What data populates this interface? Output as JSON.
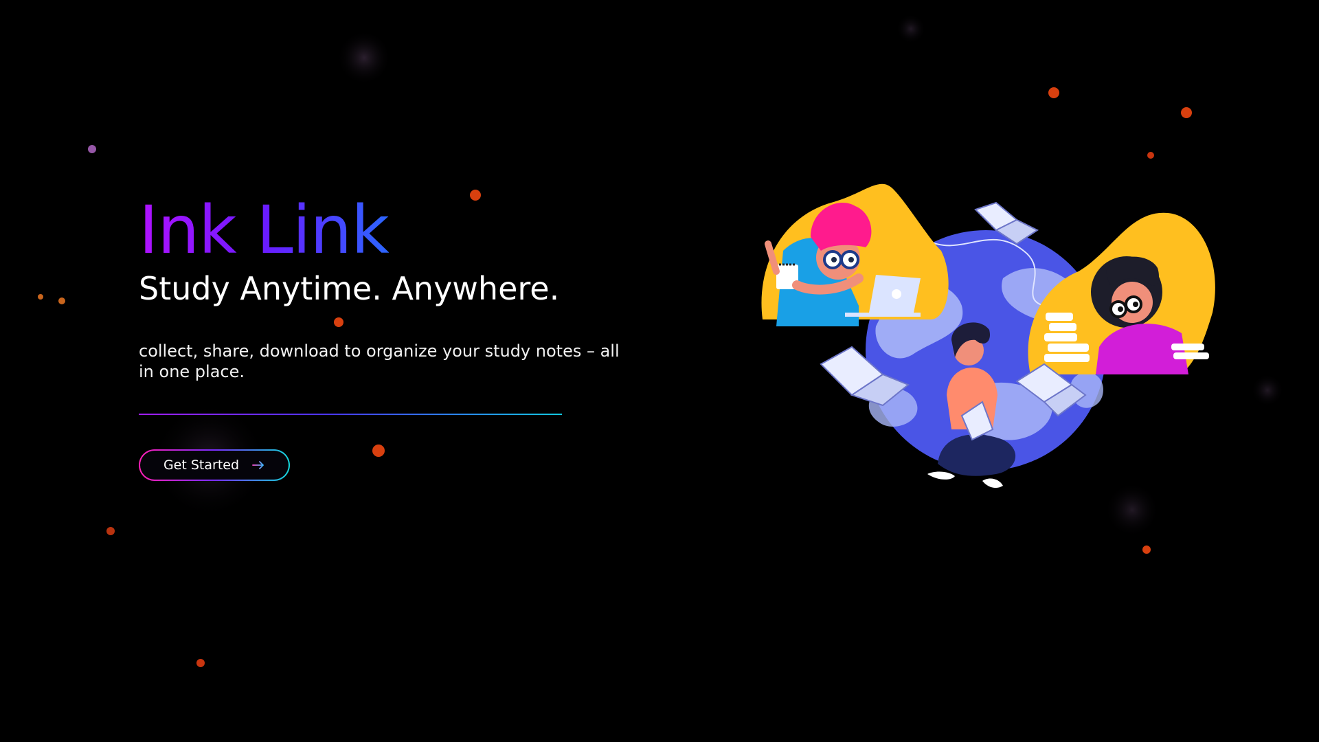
{
  "hero": {
    "title": "Ink Link",
    "tagline": "Study Anytime. Anywhere.",
    "description": "collect, share, download to organize your study notes – all in one place.",
    "cta_label": "Get Started"
  },
  "icons": {
    "cta_arrow": "arrow-right-icon"
  },
  "colors": {
    "background": "#000000",
    "title_gradient": [
      "#b012ff",
      "#6a1bff",
      "#2c66ff"
    ],
    "divider_gradient": [
      "#a21dff",
      "#4a36ff",
      "#12c8e0"
    ],
    "button_border_gradient": [
      "#ff1fb6",
      "#7a2dff",
      "#14d6d9"
    ],
    "particle": "#d8400f",
    "illustration_blob": "#ffb31a",
    "illustration_globe": "#4a55e6"
  }
}
